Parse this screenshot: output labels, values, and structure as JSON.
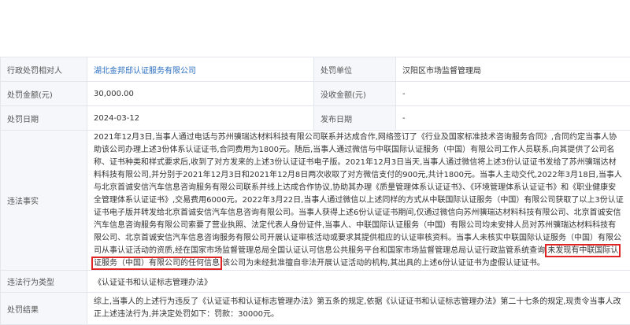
{
  "rows": {
    "party": {
      "label": "行政处罚相对人",
      "value": "湖北金邦邸认证服务有限公司"
    },
    "unit": {
      "label": "处罚单位",
      "value": "汉阳区市场监督管理局"
    },
    "amount": {
      "label": "处罚金额(元)",
      "value": "30,000.00"
    },
    "confiscated": {
      "label": "没收金额(元)",
      "value": "-"
    },
    "date": {
      "label": "处罚日期",
      "value": "2024-03-12"
    },
    "publish": {
      "label": "发布日期",
      "value": "-"
    },
    "facts": {
      "label": "违法事实",
      "text_before": "2021年12月3日,当事人通过电话与苏州骥瑞达材料科技有限公司联系并达成合作,网络签订了《行业及国家标准技术咨询服务合同》,合同约定当事人协助该公司办理上述3份体系认证证书,合同费用为1800元。随后,当事人通过微信与中联国际认证服务（中国）有限公司工作人员联系,向其提供了公司名称、证书种类和样式要求后,收到了对方发来的上述3份认证证书电子版。2021年12月3日当天,当事人通过微信将上述3份认证证书发给了苏州骥瑞达材料科技有限公司,并分别于2021年12月3日和2021年12月8日两次收取了对方微信支付的900元,共计1800元。当事人主动交代,2022年3月18日,当事人与北京首诚安信汽车信息咨询服务有限公司联系并线上达成合作协议,协助其办理《质量管理体系认证证书》、《环境管理体系认证证书》和《职业健康安全管理体系认证证书》,交易费用6000元。2022年3月22日,当事人通过微信以上述同样的方式从中联国际认证服务（中国）有限公司获取了以上3份认证证书电子版并转发给北京首诚安信汽车信息咨询有限公司。当事人获得上述6份认证证书期间,仅通过微信向苏州骥瑞达材料科技有限公司、北京首诚安信汽车信息咨询服务有限公司索要了营业执照、法定代表人身份证件,当事人、中联国际认证服务（中国）有限公司均未安排人员对苏州骥瑞达材料科技有限公司、北京首诚安信汽车信息咨询服务有限公司开展认证审核活动或要求其提供相应的认证审核资料。当事人未核实中联国际认证服务（中国）有限公司从事认证活动的资质,经在国家市场监督管理总局全国认证认可信息公共服务平台和国家市场监督管理总局认证行政监管系统查询,",
      "highlight": "未发现有中联国际认证服务（中国）有限公司的任何信息",
      "text_after": ",该公司为未经批准擅自非法开展认证活动的机构,其出具的上述6份认证证书为虚假认证证书。"
    },
    "type": {
      "label": "违法行为类型",
      "value": "《认证证书和认证标志管理办法》"
    },
    "result": {
      "label": "处罚结果",
      "value": "综上,当事人的上述行为违反了《认证证书和认证标志管理办法》第五条的规定,依据《认证证书和认证标志管理办法》第二十七条的规定,现责令当事人改正上述违法行为,并决定处罚如下：罚款：30000元。"
    }
  }
}
